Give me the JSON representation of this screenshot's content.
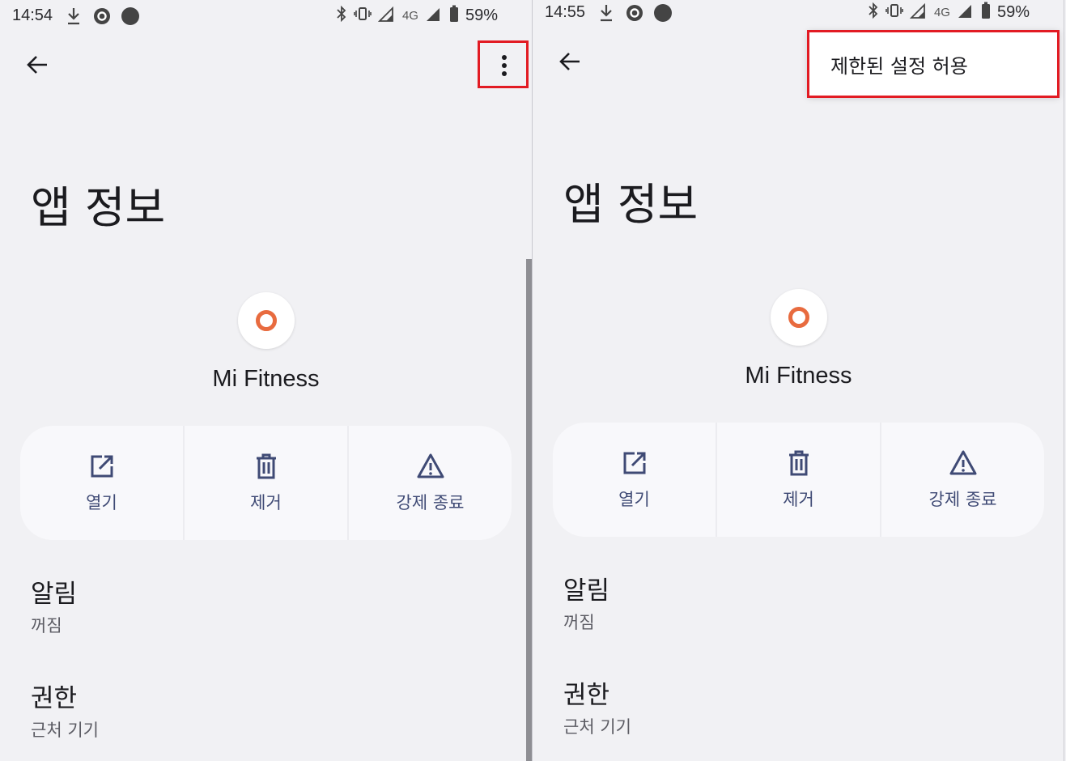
{
  "left": {
    "status_bar": {
      "time": "14:54",
      "network": "4G",
      "battery": "59%"
    },
    "title": "앱 정보",
    "app_name": "Mi Fitness",
    "actions": [
      {
        "label": "열기",
        "icon": "open-in-new-icon"
      },
      {
        "label": "제거",
        "icon": "trash-icon"
      },
      {
        "label": "강제 종료",
        "icon": "warning-icon"
      }
    ],
    "settings": [
      {
        "title": "알림",
        "subtitle": "꺼짐"
      },
      {
        "title": "권한",
        "subtitle": "근처 기기"
      }
    ]
  },
  "right": {
    "status_bar": {
      "time": "14:55",
      "network": "4G",
      "battery": "59%"
    },
    "title": "앱 정보",
    "app_name": "Mi Fitness",
    "actions": [
      {
        "label": "열기",
        "icon": "open-in-new-icon"
      },
      {
        "label": "제거",
        "icon": "trash-icon"
      },
      {
        "label": "강제 종료",
        "icon": "warning-icon"
      }
    ],
    "settings": [
      {
        "title": "알림",
        "subtitle": "꺼짐"
      },
      {
        "title": "권한",
        "subtitle": "근처 기기"
      }
    ],
    "menu": {
      "item": "제한된 설정 허용"
    }
  },
  "colors": {
    "highlight": "#e21b23",
    "accent": "#3f4a75",
    "app_icon": "#e86b3f",
    "background": "#f1f1f4"
  }
}
